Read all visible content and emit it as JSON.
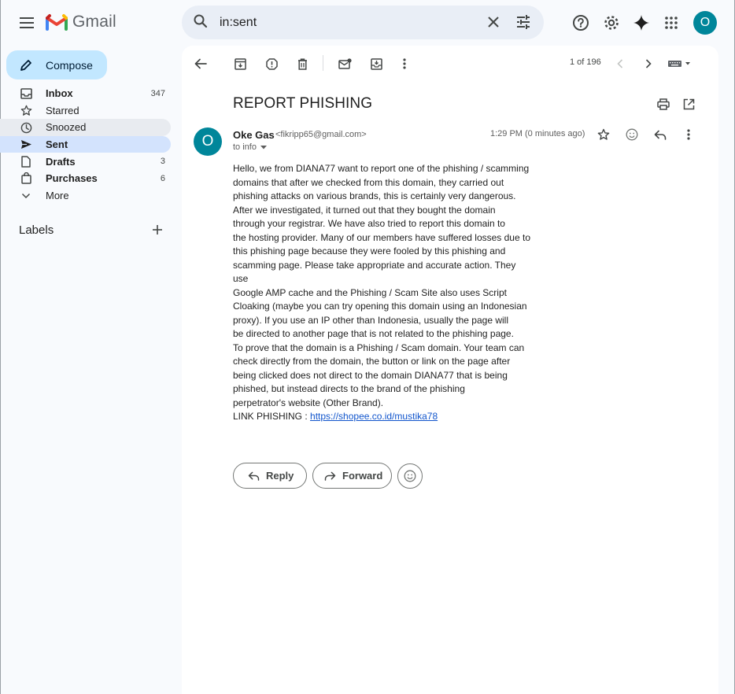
{
  "app": {
    "name": "Gmail"
  },
  "search": {
    "value": "in:sent"
  },
  "account": {
    "initial": "O"
  },
  "sidebar": {
    "compose_label": "Compose",
    "items": [
      {
        "label": "Inbox",
        "count": "347",
        "icon": "inbox-icon",
        "bold": true
      },
      {
        "label": "Starred",
        "count": "",
        "icon": "star-icon"
      },
      {
        "label": "Snoozed",
        "count": "",
        "icon": "clock-icon"
      },
      {
        "label": "Sent",
        "count": "",
        "icon": "send-icon",
        "active": true,
        "bold": true
      },
      {
        "label": "Drafts",
        "count": "3",
        "icon": "draft-icon",
        "bold": true
      },
      {
        "label": "Purchases",
        "count": "6",
        "icon": "shopping-bag-icon",
        "bold": true
      },
      {
        "label": "More",
        "count": "",
        "icon": "chevron-down-icon"
      }
    ],
    "labels_title": "Labels"
  },
  "message_view": {
    "pager": "1 of 196",
    "subject": "REPORT PHISHING",
    "sender": {
      "initial": "O",
      "name": "Oke Gas",
      "email": "<fikripp65@gmail.com>",
      "to": "to info"
    },
    "timestamp": "1:29 PM (0 minutes ago)",
    "body_lines": [
      "Hello, we from DIANA77 want to report one of the phishing / scamming",
      "domains that after we checked from this domain, they carried out",
      "phishing attacks on various brands, this is certainly very dangerous.",
      "After we investigated, it turned out that they bought the domain",
      "through your registrar. We have also tried to report this domain to",
      "the hosting provider. Many of our members have suffered losses due to",
      "this phishing page because they were fooled by this phishing and",
      "scamming page. Please take appropriate and accurate action. They use",
      "Google AMP cache and the Phishing / Scam Site also uses Script",
      "Cloaking (maybe you can try opening this domain using an Indonesian",
      "proxy). If you use an IP other than Indonesia, usually the page will",
      "be directed to another page that is not related to the phishing page.",
      "To prove that the domain is a Phishing / Scam domain. Your team can",
      "check directly from the domain, the button or link on the page after",
      "being clicked does not direct to the domain DIANA77 that is being",
      "phished, but instead directs to the brand of the phishing",
      "perpetrator's website (Other Brand)."
    ],
    "link_prefix": "LINK PHISHING : ",
    "link_text": "https://shopee.co.id/mustika78",
    "reply_label": "Reply",
    "forward_label": "Forward"
  },
  "colors": {
    "accent": "#0b57d0",
    "avatar": "#00869a",
    "compose_bg": "#c2e7ff",
    "active_nav": "#d3e3fd",
    "link": "#1155cc"
  }
}
